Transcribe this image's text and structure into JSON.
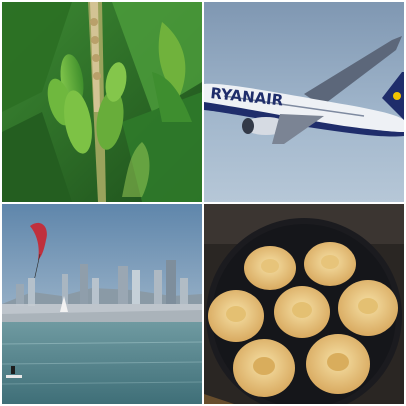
{
  "grid": {
    "tiles": [
      {
        "subject": "banana-plant",
        "palette": [
          "#2f7a2a",
          "#8cc63f",
          "#d9c79a"
        ]
      },
      {
        "subject": "airplane",
        "palette": [
          "#8fa9c4",
          "#1f2d6b",
          "#f2c300"
        ],
        "livery_text": "RYANAIR"
      },
      {
        "subject": "city-kitesurfing",
        "palette": [
          "#6a8fb0",
          "#4b7f8a",
          "#c0303d"
        ]
      },
      {
        "subject": "pancake-pan",
        "palette": [
          "#1b1b1f",
          "#f2d58c",
          "#c48a3a"
        ]
      }
    ]
  }
}
